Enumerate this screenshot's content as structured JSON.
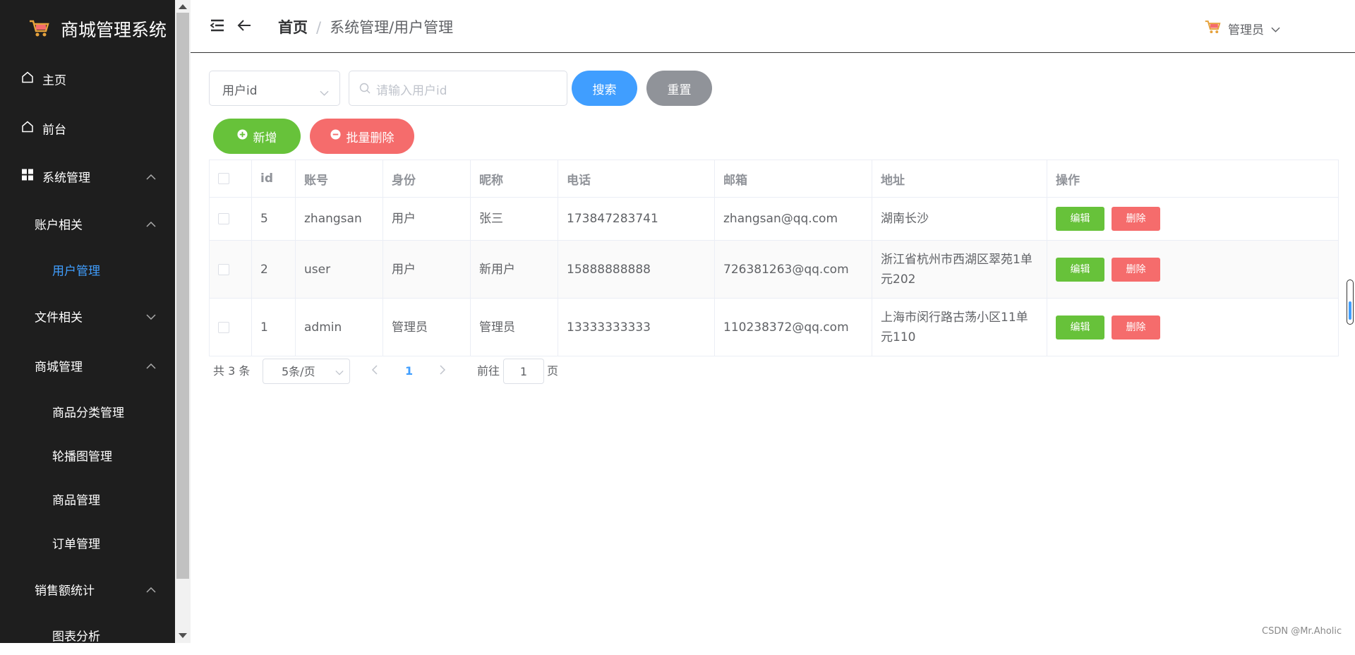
{
  "app": {
    "title": "商城管理系统"
  },
  "sidebar": {
    "items": [
      {
        "label": "主页"
      },
      {
        "label": "前台"
      },
      {
        "label": "系统管理"
      },
      {
        "label": "账户相关"
      },
      {
        "label": "用户管理"
      },
      {
        "label": "文件相关"
      },
      {
        "label": "商城管理"
      },
      {
        "label": "商品分类管理"
      },
      {
        "label": "轮播图管理"
      },
      {
        "label": "商品管理"
      },
      {
        "label": "订单管理"
      },
      {
        "label": "销售额统计"
      },
      {
        "label": "图表分析"
      }
    ]
  },
  "header": {
    "breadcrumb": {
      "home": "首页",
      "separator": "/",
      "current": "系统管理/用户管理"
    },
    "user": "管理员"
  },
  "search": {
    "field_select": "用户id",
    "placeholder": "请输入用户id",
    "search_label": "搜索",
    "reset_label": "重置"
  },
  "actions": {
    "add_label": "新增",
    "batch_delete_label": "批量删除"
  },
  "table": {
    "headers": [
      "id",
      "账号",
      "身份",
      "昵称",
      "电话",
      "邮箱",
      "地址",
      "操作"
    ],
    "rows": [
      {
        "id": "5",
        "account": "zhangsan",
        "role": "用户",
        "nickname": "张三",
        "phone": "173847283741",
        "email": "zhangsan@qq.com",
        "address": "湖南长沙"
      },
      {
        "id": "2",
        "account": "user",
        "role": "用户",
        "nickname": "新用户",
        "phone": "15888888888",
        "email": "726381263@qq.com",
        "address": "浙江省杭州市西湖区翠苑1单元202"
      },
      {
        "id": "1",
        "account": "admin",
        "role": "管理员",
        "nickname": "管理员",
        "phone": "13333333333",
        "email": "110238372@qq.com",
        "address": "上海市闵行路古荡小区11单元110"
      }
    ],
    "edit_label": "编辑",
    "delete_label": "删除"
  },
  "pagination": {
    "total_text": "共 3 条",
    "page_size": "5条/页",
    "current_page": "1",
    "goto_prefix": "前往",
    "goto_value": "1",
    "goto_suffix": "页"
  },
  "watermark": "CSDN @Mr.Aholic",
  "colors": {
    "primary": "#409eff",
    "success": "#67c23a",
    "danger": "#f56c6c",
    "info": "#909399",
    "sidebar": "#1e1e1e"
  }
}
